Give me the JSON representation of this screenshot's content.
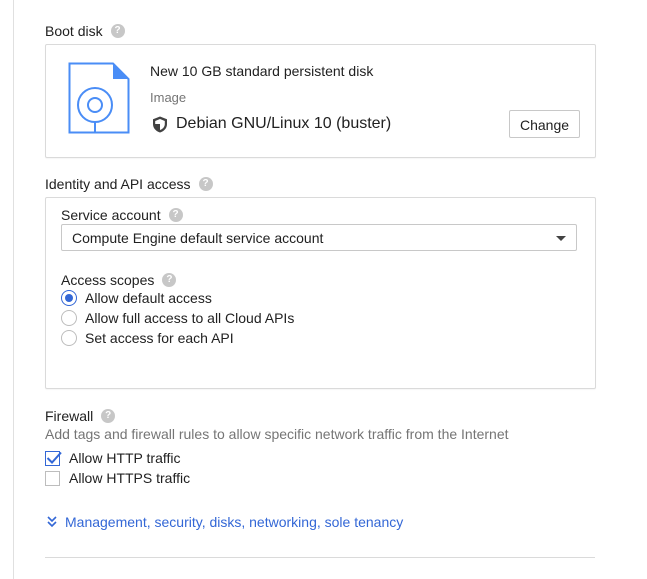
{
  "boot_disk": {
    "title": "Boot disk",
    "disk_name": "New 10 GB standard persistent disk",
    "type_label": "Image",
    "os_name": "Debian GNU/Linux 10 (buster)",
    "change_button": "Change"
  },
  "identity": {
    "title": "Identity and API access",
    "service_account": {
      "label": "Service account",
      "selected": "Compute Engine default service account"
    },
    "access_scopes": {
      "label": "Access scopes",
      "options": [
        {
          "label": "Allow default access",
          "selected": true
        },
        {
          "label": "Allow full access to all Cloud APIs",
          "selected": false
        },
        {
          "label": "Set access for each API",
          "selected": false
        }
      ]
    }
  },
  "firewall": {
    "title": "Firewall",
    "description": "Add tags and firewall rules to allow specific network traffic from the Internet",
    "options": [
      {
        "label": "Allow HTTP traffic",
        "checked": true
      },
      {
        "label": "Allow HTTPS traffic",
        "checked": false
      }
    ]
  },
  "expand_link": "Management, security, disks, networking, sole tenancy",
  "colors": {
    "accent": "#3367d6",
    "help_icon": "#c7c7c7",
    "border": "#dadada",
    "muted_text": "#757575"
  },
  "icons": {
    "help": "question-circle-icon",
    "disk": "disk-image-icon",
    "shield": "shield-icon",
    "dropdown": "caret-down-icon",
    "expand": "double-chevron-down-icon",
    "check": "checkmark-icon"
  }
}
